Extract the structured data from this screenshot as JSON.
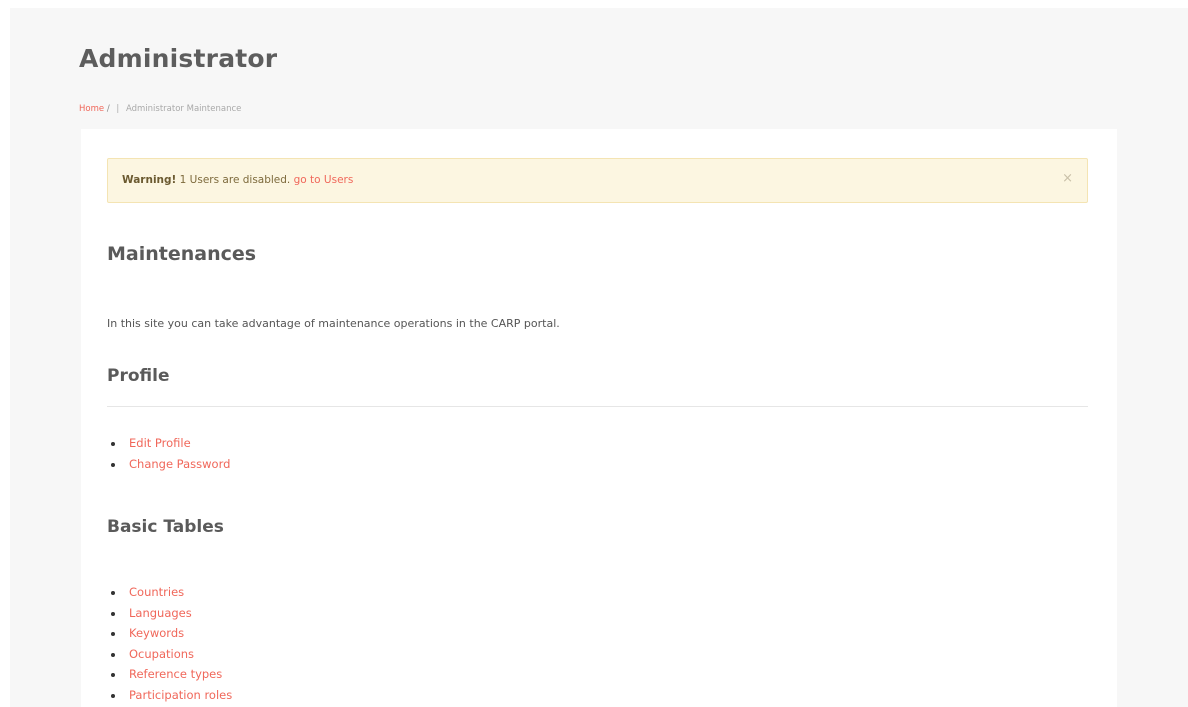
{
  "header": {
    "title": "Administrator"
  },
  "breadcrumb": {
    "home": "Home",
    "separator": "/",
    "divider": "|",
    "current": "Administrator Maintenance"
  },
  "alert": {
    "label": "Warning!",
    "message": " 1 Users are disabled. ",
    "link": "go to Users",
    "close": "×"
  },
  "maintenances": {
    "title": "Maintenances",
    "intro": "In this site you can take advantage of maintenance operations in the CARP portal."
  },
  "profile": {
    "title": "Profile",
    "links": [
      "Edit Profile",
      "Change Password"
    ]
  },
  "basic_tables": {
    "title": "Basic Tables",
    "links": [
      "Countries",
      "Languages",
      "Keywords",
      "Ocupations",
      "Reference types",
      "Participation roles"
    ]
  },
  "colors": {
    "accent": "#f0675a",
    "alert_bg": "#fcf6e1",
    "page_bg": "#f7f7f7"
  }
}
